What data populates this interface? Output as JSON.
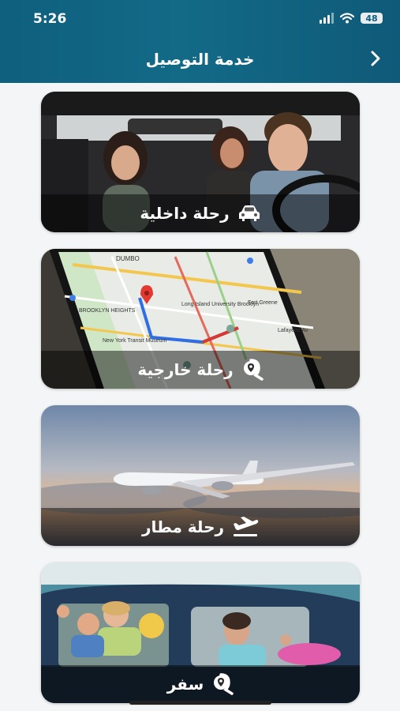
{
  "status_bar": {
    "time": "5:26",
    "battery": "48"
  },
  "header": {
    "title": "خدمة التوصيل",
    "back_icon": "chevron-right-icon"
  },
  "colors": {
    "header": "#126a87",
    "background": "#f4f5f6",
    "overlay": "rgba(0,0,0,0.48)"
  },
  "services": [
    {
      "label": "رحلة داخلية",
      "icon": "car-icon"
    },
    {
      "label": "رحلة خارجية",
      "icon": "location-search-icon"
    },
    {
      "label": "رحلة مطار",
      "icon": "plane-takeoff-icon"
    },
    {
      "label": "سفر",
      "icon": "location-search-icon"
    }
  ],
  "map_photo": {
    "place_names": [
      "DUMBO",
      "BROOKLYN HEIGHTS",
      "Long Island University Brooklyn",
      "Fort Greene",
      "New York Transit Museum",
      "Lafayette Av"
    ]
  }
}
